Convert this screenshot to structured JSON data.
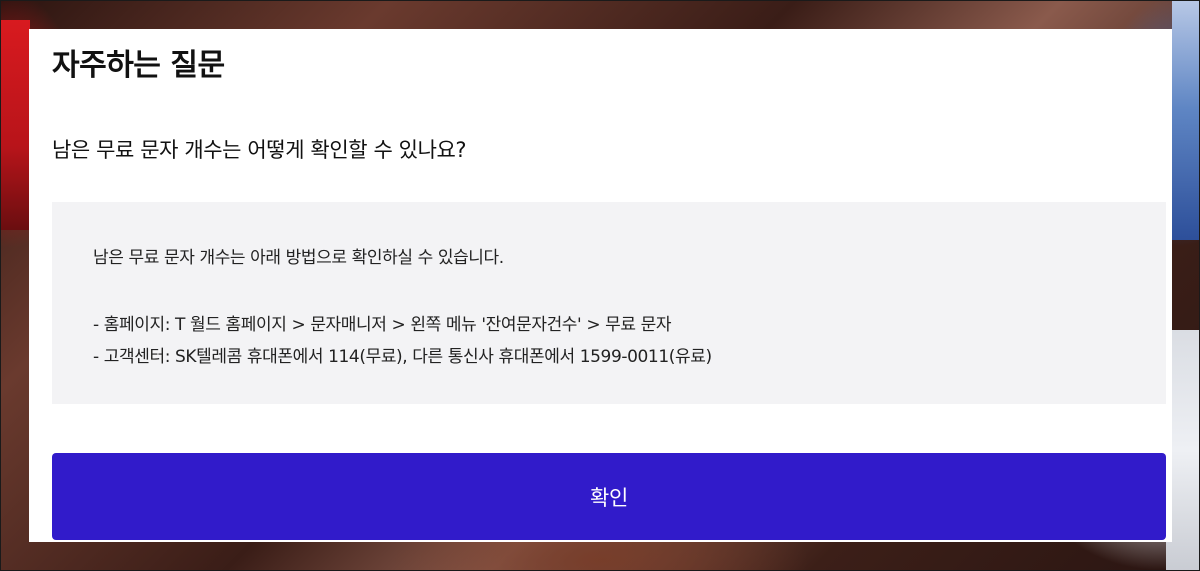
{
  "modal": {
    "title": "자주하는 질문",
    "question": "남은 무료 문자 개수는 어떻게 확인할 수 있나요?",
    "answer": {
      "intro": "남은 무료 문자 개수는 아래 방법으로 확인하실 수 있습니다.",
      "lines": [
        "- 홈페이지: T 월드 홈페이지 > 문자매니저 > 왼쪽 메뉴 '잔여문자건수' > 무료 문자",
        "- 고객센터: SK텔레콤 휴대폰에서 114(무료), 다른 통신사 휴대폰에서 1599-0011(유료)"
      ]
    },
    "confirm_label": "확인"
  },
  "colors": {
    "button_bg": "#311bca",
    "answer_bg": "#f3f3f5",
    "modal_bg": "#ffffff"
  }
}
